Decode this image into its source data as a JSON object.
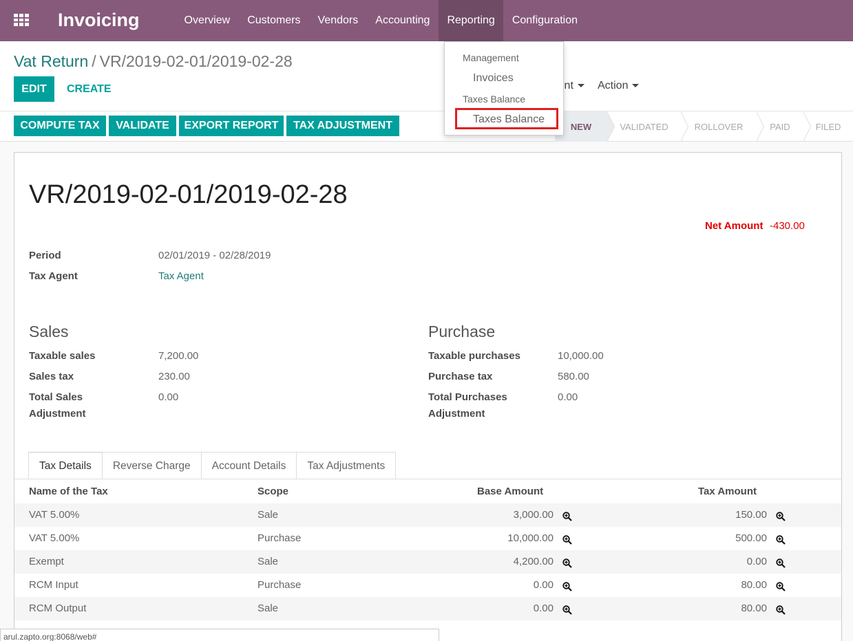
{
  "navbar": {
    "brand": "Invoicing",
    "menu": [
      "Overview",
      "Customers",
      "Vendors",
      "Accounting",
      "Reporting",
      "Configuration"
    ]
  },
  "breadcrumb": {
    "parent": "Vat Return",
    "separator": "/",
    "current": "VR/2019-02-01/2019-02-28"
  },
  "buttons": {
    "edit": "EDIT",
    "create": "CREATE",
    "print": "int",
    "action": "Action"
  },
  "statusbar": {
    "buttons": [
      "COMPUTE TAX",
      "VALIDATE",
      "EXPORT REPORT",
      "TAX ADJUSTMENT"
    ],
    "stages": [
      "NEW",
      "VALIDATED",
      "ROLLOVER",
      "PAID",
      "FILED"
    ],
    "current_stage": "NEW"
  },
  "reporting_dropdown": {
    "header_management": "Management",
    "item_invoices": "Invoices",
    "header_taxes": "Taxes Balance",
    "item_taxes_balance": "Taxes Balance"
  },
  "record": {
    "title": "VR/2019-02-01/2019-02-28",
    "net_amount_label": "Net Amount",
    "net_amount": "-430.00",
    "period_label": "Period",
    "period": "02/01/2019 - 02/28/2019",
    "tax_agent_label": "Tax Agent",
    "tax_agent": "Tax Agent"
  },
  "sales": {
    "title": "Sales",
    "taxable_label": "Taxable sales",
    "taxable": "7,200.00",
    "tax_label": "Sales tax",
    "tax": "230.00",
    "adj_label_1": "Total Sales",
    "adj_label_2": "Adjustment",
    "adj": "0.00"
  },
  "purchase": {
    "title": "Purchase",
    "taxable_label": "Taxable purchases",
    "taxable": "10,000.00",
    "tax_label": "Purchase tax",
    "tax": "580.00",
    "adj_label_1": "Total Purchases",
    "adj_label_2": "Adjustment",
    "adj": "0.00"
  },
  "tabs": [
    "Tax Details",
    "Reverse Charge",
    "Account Details",
    "Tax Adjustments"
  ],
  "table": {
    "headers": [
      "Name of the Tax",
      "Scope",
      "Base Amount",
      "Tax Amount"
    ],
    "rows": [
      [
        "VAT 5.00%",
        "Sale",
        "3,000.00",
        "150.00"
      ],
      [
        "VAT 5.00%",
        "Purchase",
        "10,000.00",
        "500.00"
      ],
      [
        "Exempt",
        "Sale",
        "4,200.00",
        "0.00"
      ],
      [
        "RCM Input",
        "Purchase",
        "0.00",
        "80.00"
      ],
      [
        "RCM Output",
        "Sale",
        "0.00",
        "80.00"
      ]
    ]
  },
  "status_url": "arul.zapto.org:8068/web#",
  "colors": {
    "navbar": "#875a7b",
    "primary": "#00a09d",
    "negative": "#e00000",
    "highlight": "#e02020"
  },
  "icons": {
    "apps": "apps-grid-icon",
    "zoom": "zoom-in-icon"
  }
}
